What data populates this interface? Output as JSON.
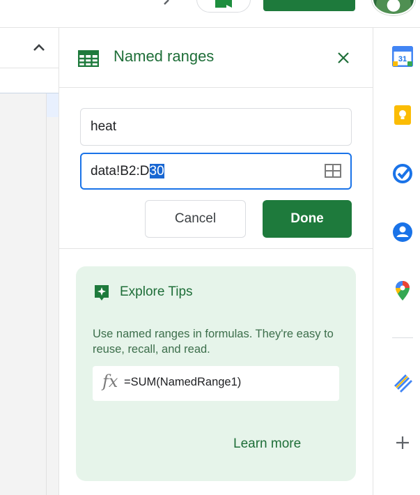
{
  "panel": {
    "title": "Named ranges",
    "name_value": "heat",
    "range_value_prefix": "data!B2:D",
    "range_value_selected": "30",
    "cancel_label": "Cancel",
    "done_label": "Done"
  },
  "tips": {
    "title": "Explore Tips",
    "body": "Use named ranges in formulas. They're easy to reuse, recall, and read.",
    "formula_symbol": "fx",
    "formula": "=SUM(NamedRange1)",
    "learn_more": "Learn more"
  },
  "rail": {
    "calendar_day": "31"
  },
  "colors": {
    "brand_green": "#1e7a3c",
    "title_green": "#1e6e38",
    "focus_blue": "#1a73e8",
    "tips_bg": "#e6f4ea"
  },
  "icons": {
    "panel": "spreadsheet-grid-icon",
    "close": "close-icon",
    "range_picker": "range-select-icon",
    "tips": "sparkle-star-icon",
    "rail": [
      "calendar-icon",
      "keep-icon",
      "tasks-icon",
      "contacts-icon",
      "maps-icon",
      "addon-icon",
      "add-icon"
    ]
  }
}
